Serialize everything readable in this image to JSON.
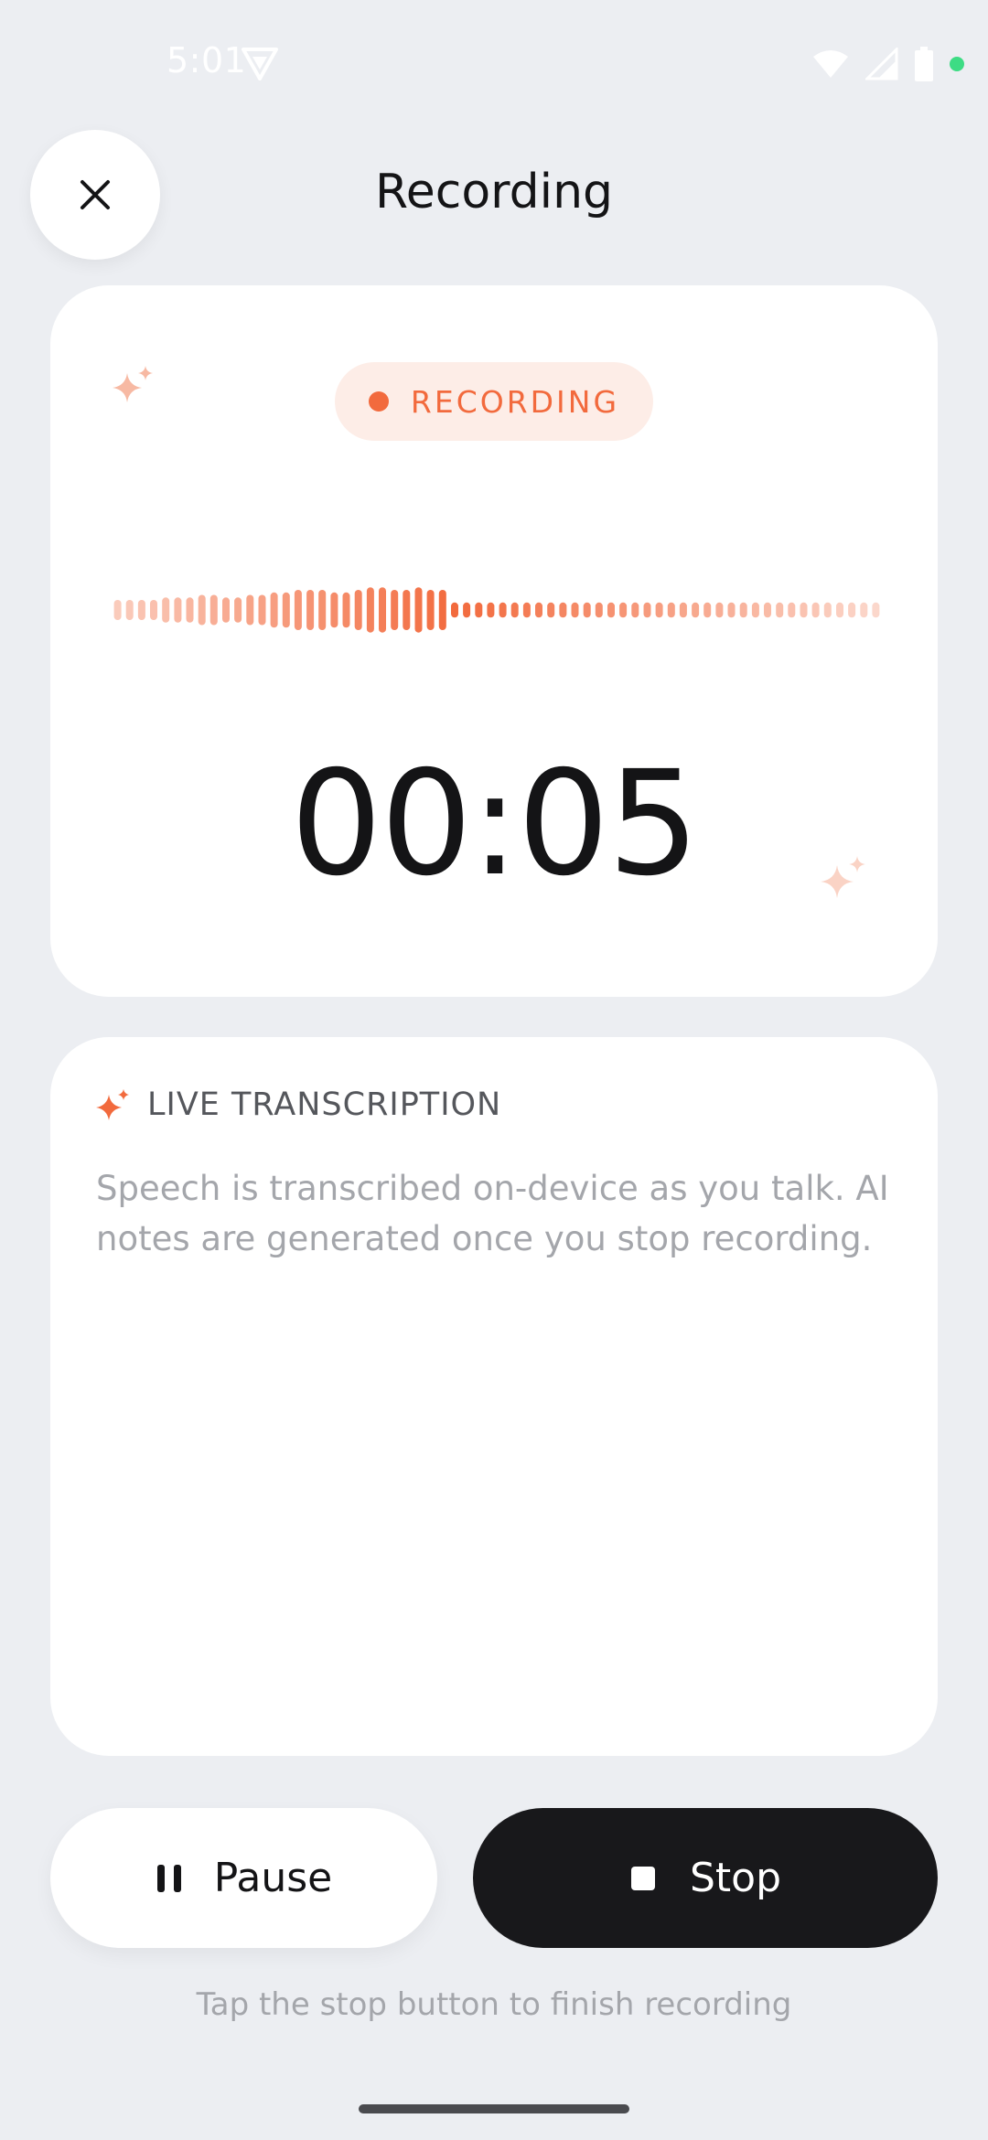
{
  "status_bar": {
    "time": "5:01"
  },
  "header": {
    "title": "Recording",
    "close_icon": "close-icon"
  },
  "recording_card": {
    "badge_label": "RECORDING",
    "timer": "00:05",
    "accent_color": "#F26A3D",
    "waveform_levels": [
      0.4,
      0.4,
      0.4,
      0.4,
      0.5,
      0.5,
      0.5,
      0.6,
      0.6,
      0.5,
      0.5,
      0.6,
      0.6,
      0.7,
      0.7,
      0.8,
      0.8,
      0.8,
      0.7,
      0.7,
      0.8,
      0.9,
      0.9,
      0.8,
      0.8,
      0.9,
      0.8,
      0.8,
      0.3,
      0.3,
      0.3,
      0.3,
      0.3,
      0.3,
      0.3,
      0.3,
      0.3,
      0.3,
      0.3,
      0.3,
      0.3,
      0.3,
      0.3,
      0.3,
      0.3,
      0.3,
      0.3,
      0.3,
      0.3,
      0.3,
      0.3,
      0.3,
      0.3,
      0.3,
      0.3,
      0.3,
      0.3,
      0.3,
      0.3,
      0.3,
      0.3,
      0.3,
      0.3,
      0.3
    ]
  },
  "transcription": {
    "title": "LIVE TRANSCRIPTION",
    "body": "Speech is transcribed on-device as you talk. AI notes are generated once you stop recording."
  },
  "actions": {
    "pause_label": "Pause",
    "stop_label": "Stop"
  },
  "hint": "Tap the stop button to finish recording"
}
